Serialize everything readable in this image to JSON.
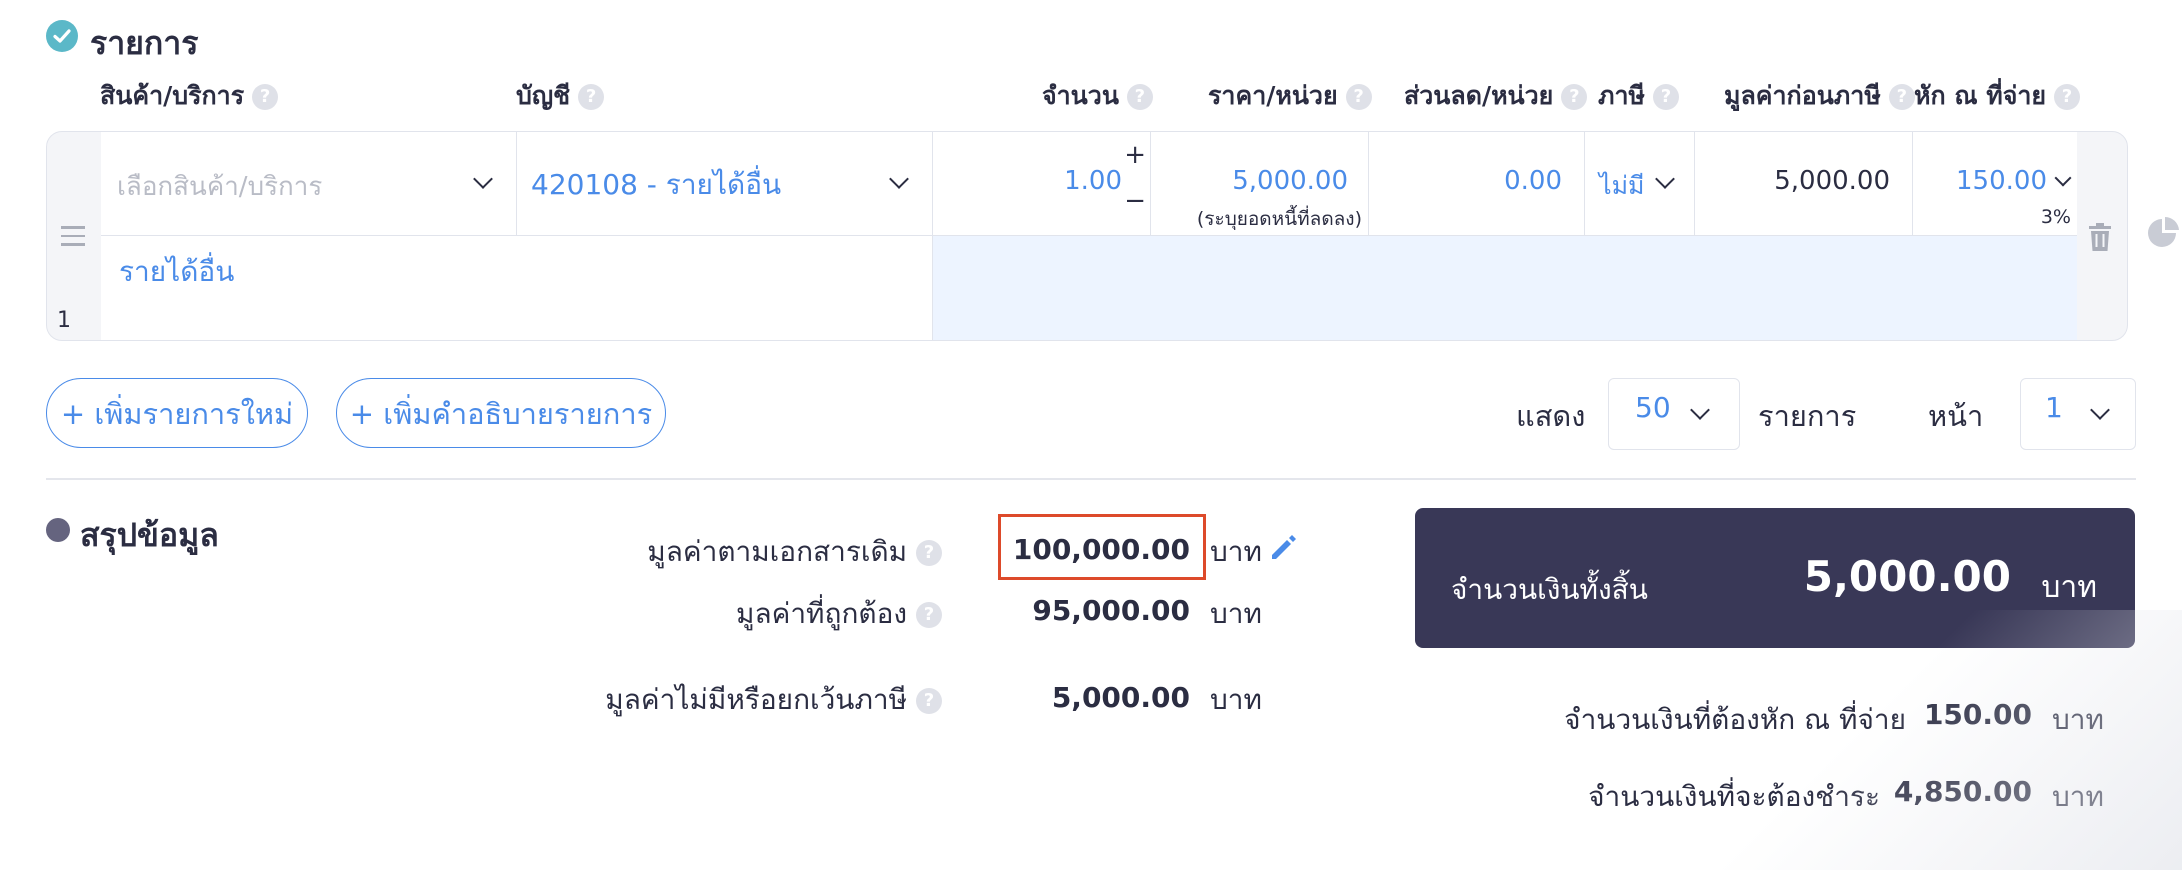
{
  "items_section": {
    "title": "รายการ"
  },
  "columns": {
    "product": "สินค้า/บริการ",
    "account": "บัญชี",
    "quantity": "จำนวน",
    "unit_price": "ราคา/หน่วย",
    "discount": "ส่วนลด/หน่วย",
    "tax": "ภาษี",
    "pre_tax": "มูลค่าก่อนภาษี",
    "withholding": "หัก ณ ที่จ่าย"
  },
  "row": {
    "number": "1",
    "product_placeholder": "เลือกสินค้า/บริการ",
    "account": "420108 - รายได้อื่น",
    "quantity": "1.00",
    "plus": "+",
    "minus": "−",
    "unit_price": "5,000.00",
    "unit_price_note": "(ระบุยอดหนี้ที่ลดลง)",
    "discount": "0.00",
    "tax": "ไม่มี",
    "pre_tax": "5,000.00",
    "withholding": "150.00",
    "withholding_rate": "3%",
    "description": "รายได้อื่น"
  },
  "actions": {
    "add_item": "+ เพิ่มรายการใหม่",
    "add_description": "+ เพิ่มคำอธิบายรายการ"
  },
  "pagination": {
    "show_label": "แสดง",
    "per_page": "50",
    "items_label": "รายการ",
    "page_label": "หน้า",
    "page": "1"
  },
  "summary": {
    "title": "สรุปข้อมูล",
    "original_label": "มูลค่าตามเอกสารเดิม",
    "original_value": "100,000.00",
    "correct_label": "มูลค่าที่ถูกต้อง",
    "correct_value": "95,000.00",
    "no_tax_label": "มูลค่าไม่มีหรือยกเว้นภาษี",
    "no_tax_value": "5,000.00",
    "unit": "บาท"
  },
  "totals": {
    "grand_label": "จำนวนเงินทั้งสิ้น",
    "grand_value": "5,000.00",
    "unit": "บาท",
    "withholding_label": "จำนวนเงินที่ต้องหัก ณ ที่จ่าย",
    "withholding_value": "150.00",
    "payable_label": "จำนวนเงินที่จะต้องชำระ",
    "payable_value": "4,850.00"
  },
  "colors": {
    "accent": "#4a8be8",
    "dark_panel": "#393857",
    "highlight": "#dd4a2a",
    "check": "#5bb8c8"
  }
}
